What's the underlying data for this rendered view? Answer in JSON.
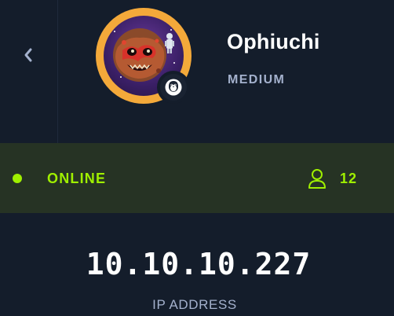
{
  "machine": {
    "name": "Ophiuchi",
    "difficulty": "MEDIUM",
    "os_icon": "linux-penguin-icon",
    "avatar": "planet-monster-avatar"
  },
  "status": {
    "label": "ONLINE",
    "players_count": "12",
    "color": "#9fef00",
    "players_icon": "user-icon"
  },
  "network": {
    "ip": "10.10.10.227",
    "ip_label": "IP ADDRESS"
  },
  "nav": {
    "back_icon": "chevron-left-icon"
  },
  "colors": {
    "background": "#141d2b",
    "status_bar": "#263324",
    "avatar_ring": "#f4a93a",
    "muted_text": "#a4b1cd"
  }
}
